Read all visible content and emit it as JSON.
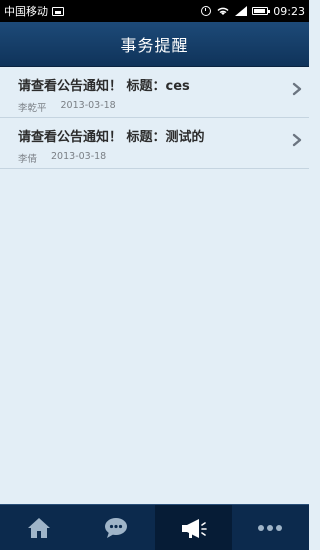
{
  "status_bar": {
    "carrier": "中国移动",
    "time": "09:23",
    "icons": [
      "image-icon",
      "alarm-icon",
      "wifi-icon",
      "signal-icon",
      "battery-icon"
    ]
  },
  "header": {
    "title": "事务提醒"
  },
  "items": [
    {
      "title": "请查看公告通知！ 标题：ces",
      "author": "李乾平",
      "date": "2013-03-18"
    },
    {
      "title": "请查看公告通知！ 标题：测试的",
      "author": "李倩",
      "date": "2013-03-18"
    }
  ],
  "bottom_nav": {
    "tabs": [
      {
        "icon": "home-icon"
      },
      {
        "icon": "chat-icon"
      },
      {
        "icon": "megaphone-icon",
        "active": true
      },
      {
        "icon": "more-icon"
      }
    ]
  },
  "colors": {
    "header": "#1d4a78",
    "background": "#e3eef6",
    "nav": "#0c2a4d"
  }
}
